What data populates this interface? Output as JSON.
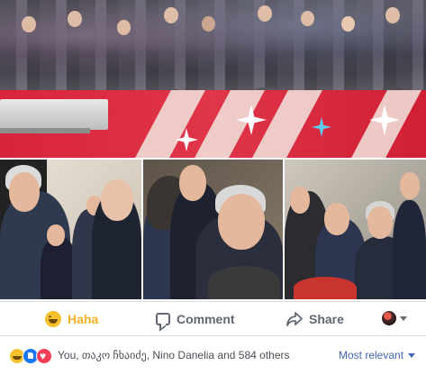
{
  "actions": {
    "reaction_label": "Haha",
    "comment_label": "Comment",
    "share_label": "Share"
  },
  "reactions": {
    "summary": "You, თაკო ჩხაიძე, Nino Danelia and 584 others",
    "icons": [
      "haha-icon",
      "like-icon",
      "love-icon"
    ]
  },
  "sort": {
    "label": "Most relevant"
  },
  "colors": {
    "haha": "#f7b125",
    "link": "#4267b2",
    "like": "#1877f2",
    "love": "#f33e58"
  }
}
